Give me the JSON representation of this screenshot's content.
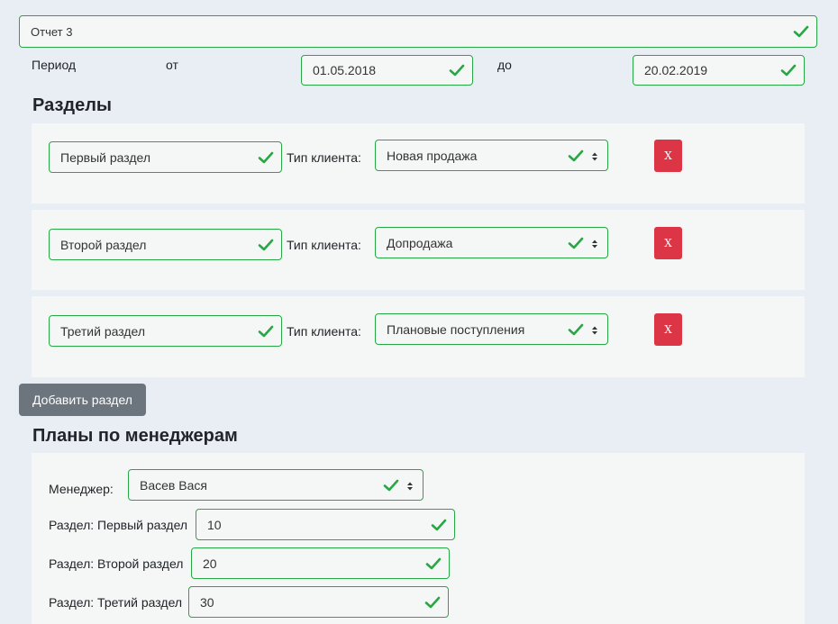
{
  "report": {
    "name_value": "Отчет 3"
  },
  "period": {
    "label": "Период",
    "from_label": "от",
    "from_value": "01.05.2018",
    "to_label": "до",
    "to_value": "20.02.2019"
  },
  "sections": {
    "heading": "Разделы",
    "client_type_label": "Тип клиента:",
    "delete_label": "X",
    "items": [
      {
        "name": "Первый раздел",
        "client_type": "Новая продажа"
      },
      {
        "name": "Второй раздел",
        "client_type": "Допродажа"
      },
      {
        "name": "Третий раздел",
        "client_type": "Плановые поступления"
      }
    ],
    "add_button_label": "Добавить раздел"
  },
  "plans": {
    "heading": "Планы по менеджерам",
    "manager_label": "Менеджер:",
    "manager_value": "Васев Вася",
    "rows": [
      {
        "label": "Раздел: Первый раздел",
        "value": "10"
      },
      {
        "label": "Раздел: Второй раздел",
        "value": "20"
      },
      {
        "label": "Раздел: Третий раздел",
        "value": "30"
      }
    ]
  },
  "colors": {
    "valid_green": "#28a745",
    "danger_red": "#dc3545",
    "secondary_gray": "#6c757d",
    "page_bg": "#e9eef5"
  }
}
